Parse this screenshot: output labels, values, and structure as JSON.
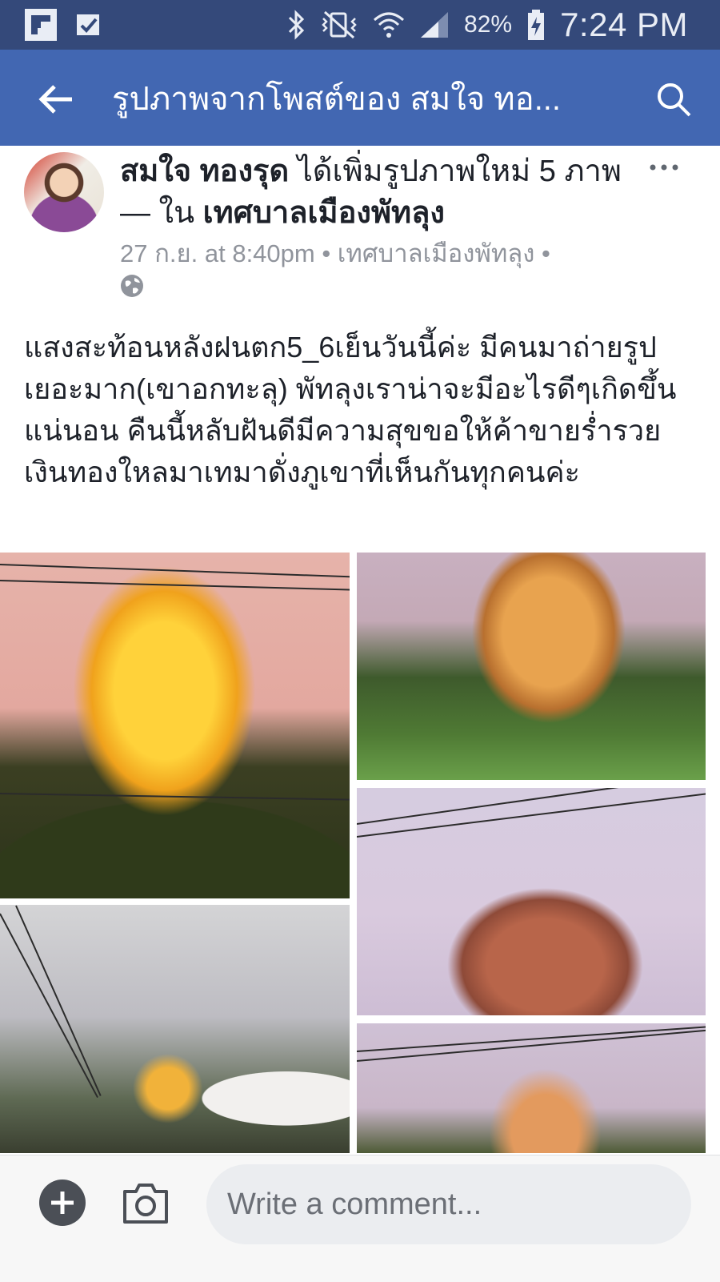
{
  "status_bar": {
    "battery_percent": "82%",
    "time": "7:24 PM",
    "icons": [
      "flipboard-icon",
      "tasks-icon",
      "bluetooth-icon",
      "vibrate-icon",
      "wifi-icon",
      "signal-icon",
      "battery-icon"
    ]
  },
  "app_bar": {
    "title": "รูปภาพจากโพสต์ของ สมใจ ทอ...",
    "bg_color": "#4267b2"
  },
  "post": {
    "author": "สมใจ ทองรุด",
    "action_text": " ได้เพิ่มรูปภาพใหม่ 5 ภาพ — ใน ",
    "place": "เทศบาลเมืองพัทลุง",
    "meta": "27 ก.ย. at 8:40pm • เทศบาลเมืองพัทลุง •",
    "body": "แสงสะท้อนหลังฝนตก5_6เย็นวันนี้ค่ะ มีคนมาถ่ายรูปเยอะมาก(เขาอกทะลุ) พัทลุงเราน่าจะมีอะไรดีๆเกิดขึ้นแน่นอน คืนนี้หลับฝันดีมีความสุขขอให้ค้าขายร่ำรวยเงินทองใหลมาเทมาดั่งภูเขาที่เห็นกันทุกคนค่ะ",
    "photo_count": 5
  },
  "comment_bar": {
    "placeholder": "Write a comment..."
  }
}
